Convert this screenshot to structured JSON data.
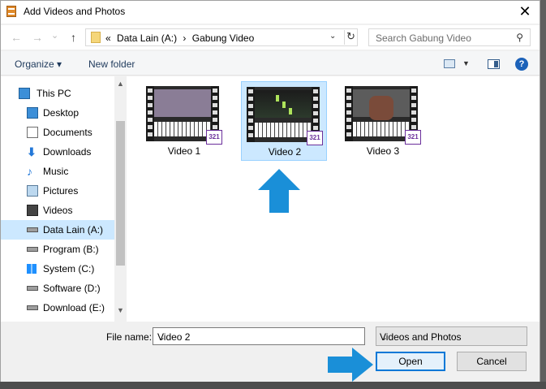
{
  "window": {
    "title": "Add Videos and Photos",
    "close_glyph": "✕"
  },
  "nav": {
    "back_glyph": "←",
    "forward_glyph": "→",
    "recent_glyph": "⌄",
    "up_glyph": "↑"
  },
  "address": {
    "overflow": "«",
    "crumbs": [
      "Data Lain (A:)",
      "›",
      "Gabung Video"
    ],
    "dropdown_glyph": "⌄",
    "refresh_glyph": "↻"
  },
  "search": {
    "placeholder": "Search Gabung Video",
    "icon_glyph": "⚲"
  },
  "toolbar": {
    "organize_label": "Organize ▾",
    "new_folder_label": "New folder",
    "view_drop_glyph": "▼",
    "help_label": "?"
  },
  "sidebar": {
    "items": [
      {
        "label": "This PC",
        "icon": "computer-icon"
      },
      {
        "label": "Desktop",
        "icon": "desktop-icon"
      },
      {
        "label": "Documents",
        "icon": "documents-icon"
      },
      {
        "label": "Downloads",
        "icon": "downloads-icon"
      },
      {
        "label": "Music",
        "icon": "music-icon"
      },
      {
        "label": "Pictures",
        "icon": "pictures-icon"
      },
      {
        "label": "Videos",
        "icon": "videos-icon"
      },
      {
        "label": "Data Lain (A:)",
        "icon": "drive-icon",
        "selected": true
      },
      {
        "label": "Program (B:)",
        "icon": "drive-icon"
      },
      {
        "label": "System (C:)",
        "icon": "windows-drive-icon"
      },
      {
        "label": "Software (D:)",
        "icon": "drive-icon"
      },
      {
        "label": "Download (E:)",
        "icon": "drive-icon"
      }
    ],
    "scroll_up_glyph": "▲",
    "scroll_down_glyph": "▼"
  },
  "files": [
    {
      "name": "Video 1",
      "badge": "321",
      "selected": false
    },
    {
      "name": "Video 2",
      "badge": "321",
      "selected": true
    },
    {
      "name": "Video 3",
      "badge": "321",
      "selected": false
    }
  ],
  "footer": {
    "file_name_label": "File name:",
    "file_name_value": "Video 2",
    "dropdown_glyph": "⌄",
    "file_type_value": "Videos and Photos",
    "open_label": "Open",
    "cancel_label": "Cancel"
  },
  "colors": {
    "selection": "#cce8ff",
    "accent": "#0078d7",
    "annotation_arrow": "#1a8fd8"
  }
}
